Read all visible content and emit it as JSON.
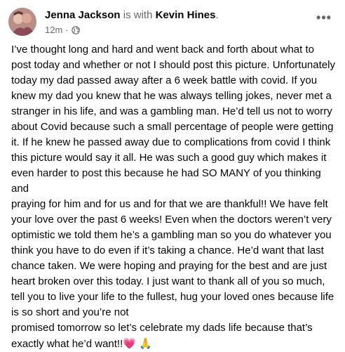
{
  "post": {
    "author": "Jenna Jackson",
    "with_text": "is with",
    "tagged": "Kevin Hines",
    "tagged_suffix": ".",
    "timestamp": "12m",
    "separator": "·",
    "privacy_icon": "globe-icon",
    "more_icon": "more-horizontal-icon",
    "body_lines": [
      "I’ve thought long and hard and went back and forth about what to",
      "post today and whether or not I should post this picture. Unfortunately",
      "today my dad passed away after a 6 week battle with covid. If you",
      "knew my dad you knew that he was always telling jokes, never met a",
      "stranger in his life, and was a gambling man. He’d tell us not to worry",
      "about Covid because such a small percentage of people were getting",
      "it. If he knew he passed away due to complications from covid I think",
      "this picture would say it all. He was such a good guy which makes it",
      "even harder to post this because he had SO MANY of you thinking and",
      "praying for him and for us and for that we are thankful!! We have felt",
      "your love over the past 6 weeks! Even when the doctors weren’t very",
      "optimistic we told them he’s a gambling man so you do whatever you",
      "think you have to do even if it’s taking a chance. He’d want that last",
      "chance taken. We were hoping and praying for the best and are just",
      "heart broken over this today. I just want to thank all of you so much,",
      "tell you to live your life to the fullest, hug your loved ones because life",
      "is so short and you’re not",
      "promised tomorrow so let’s celebrate my dads life because that’s",
      "exactly what he’d want!!"
    ],
    "end_emojis": [
      "💗",
      "🙏"
    ],
    "colors": {
      "text_primary": "#050505",
      "text_secondary": "#65676b"
    }
  }
}
